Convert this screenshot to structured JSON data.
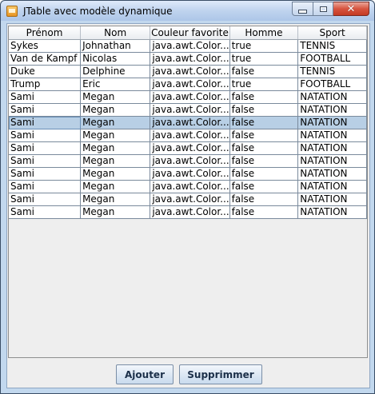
{
  "window": {
    "title": "JTable avec modèle dynamique"
  },
  "table": {
    "columns": [
      "Prénom",
      "Nom",
      "Couleur favorite",
      "Homme",
      "Sport"
    ],
    "rows": [
      [
        "Sykes",
        "Johnathan",
        "java.awt.Color...",
        "true",
        "TENNIS"
      ],
      [
        "Van de Kampf",
        "Nicolas",
        "java.awt.Color...",
        "true",
        "FOOTBALL"
      ],
      [
        "Duke",
        "Delphine",
        "java.awt.Color...",
        "false",
        "TENNIS"
      ],
      [
        "Trump",
        "Eric",
        "java.awt.Color...",
        "true",
        "FOOTBALL"
      ],
      [
        "Sami",
        "Megan",
        "java.awt.Color...",
        "false",
        "NATATION"
      ],
      [
        "Sami",
        "Megan",
        "java.awt.Color...",
        "false",
        "NATATION"
      ],
      [
        "Sami",
        "Megan",
        "java.awt.Color...",
        "false",
        "NATATION"
      ],
      [
        "Sami",
        "Megan",
        "java.awt.Color...",
        "false",
        "NATATION"
      ],
      [
        "Sami",
        "Megan",
        "java.awt.Color...",
        "false",
        "NATATION"
      ],
      [
        "Sami",
        "Megan",
        "java.awt.Color...",
        "false",
        "NATATION"
      ],
      [
        "Sami",
        "Megan",
        "java.awt.Color...",
        "false",
        "NATATION"
      ],
      [
        "Sami",
        "Megan",
        "java.awt.Color...",
        "false",
        "NATATION"
      ],
      [
        "Sami",
        "Megan",
        "java.awt.Color...",
        "false",
        "NATATION"
      ],
      [
        "Sami",
        "Megan",
        "java.awt.Color...",
        "false",
        "NATATION"
      ]
    ],
    "selected_row": 6
  },
  "buttons": {
    "add_label": "Ajouter",
    "delete_label": "Supprimmer"
  },
  "icons": {
    "app": "java-app-icon",
    "minimize": "minimize-icon",
    "maximize": "maximize-icon",
    "close": "close-icon"
  },
  "colors": {
    "selection": "#b8cfe5",
    "close_button": "#d7543f"
  }
}
